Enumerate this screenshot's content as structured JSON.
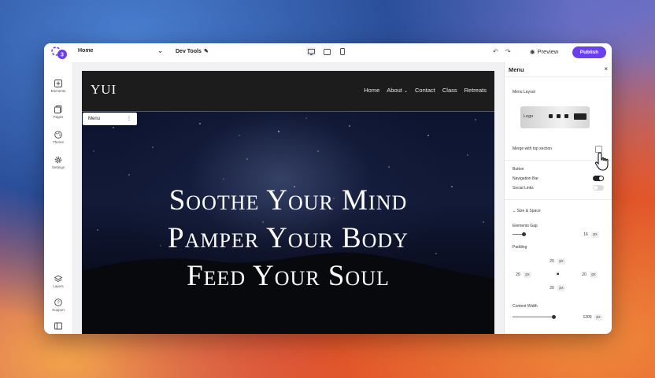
{
  "topbar": {
    "page_selector": "Home",
    "dev_tools": "Dev Tools",
    "preview": "Preview",
    "publish": "Publish",
    "logo_badge": "3"
  },
  "sidebar": {
    "items": [
      {
        "label": "Elements",
        "icon": "plus-icon"
      },
      {
        "label": "Pages",
        "icon": "pages-icon"
      },
      {
        "label": "Theme",
        "icon": "palette-icon"
      },
      {
        "label": "Settings",
        "icon": "gear-icon"
      },
      {
        "label": "Layers",
        "icon": "layers-icon"
      },
      {
        "label": "Support",
        "icon": "help-icon"
      }
    ]
  },
  "site": {
    "brand": "YUI",
    "nav": [
      "Home",
      "About",
      "Contact",
      "Class",
      "Retreats"
    ],
    "menu_tag": "Menu",
    "hero_lines": [
      "Soothe Your Mind",
      "Pamper Your Body",
      "Feed Your Soul"
    ]
  },
  "panel": {
    "title": "Menu",
    "menu_layout": "Menu Layout",
    "logo_label": "Logo",
    "merge_top": "Merge with top section",
    "button": "Button",
    "navigation_bar": "Navigation Bar",
    "social_links": "Social Links",
    "size_space": "Size & Space",
    "elements_gap": "Elements Gap",
    "gap_value": "16",
    "padding": "Padding",
    "pad_top": "20",
    "pad_left": "20",
    "pad_right": "20",
    "pad_bottom": "20",
    "content_width": "Content Width",
    "width_value": "1200",
    "unit": "px",
    "navigation_bar_on": true,
    "social_links_on": false
  },
  "colors": {
    "accent": "#6a3ff0",
    "selection": "#3a4fd0"
  }
}
